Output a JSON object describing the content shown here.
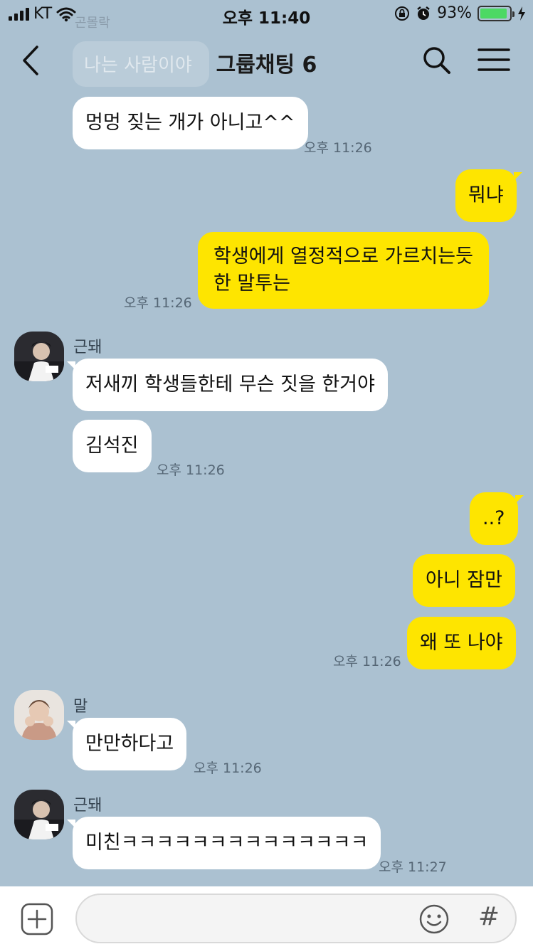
{
  "status_bar": {
    "carrier": "KT",
    "time": "오후 11:40",
    "battery_pct": "93%",
    "battery_level": 0.93,
    "battery_color": "#4cd964"
  },
  "header": {
    "title": "그룹채팅 6",
    "back_icon": "chevron-left-icon",
    "search_icon": "search-icon",
    "menu_icon": "hamburger-menu-icon"
  },
  "ghost_message": {
    "sender": "곤몰락",
    "text": "나는 사람이야"
  },
  "messages": [
    {
      "side": "in",
      "text": "멍멍 짖는 개가 아니고^^",
      "time": "오후 11:26"
    },
    {
      "side": "out",
      "text": "뭐냐"
    },
    {
      "side": "out",
      "lines": [
        "학생에게 열정적으로 가르치는듯",
        "한 말투는"
      ],
      "time": "오후 11:26"
    },
    {
      "side": "in",
      "sender": "근돼",
      "text": "저새끼 학생들한테 무슨 짓을 한거야"
    },
    {
      "side": "in",
      "text": "김석진",
      "time": "오후 11:26"
    },
    {
      "side": "out",
      "text": "..?"
    },
    {
      "side": "out",
      "text": "아니 잠만"
    },
    {
      "side": "out",
      "text": "왜 또 나야",
      "time": "오후 11:26"
    },
    {
      "side": "in",
      "sender": "말",
      "text": "만만하다고",
      "time": "오후 11:26"
    },
    {
      "side": "in",
      "sender": "근돼",
      "text": "미친ㅋㅋㅋㅋㅋㅋㅋㅋㅋㅋㅋㅋㅋㅋ",
      "time": "오후 11:27"
    }
  ],
  "input_bar": {
    "plus_icon": "plus-square-icon",
    "placeholder": "",
    "emoji_icon": "smiley-icon",
    "hash_label": "#"
  },
  "colors": {
    "background": "#abc1d1",
    "out_bubble": "#fee500",
    "in_bubble": "#ffffff"
  }
}
